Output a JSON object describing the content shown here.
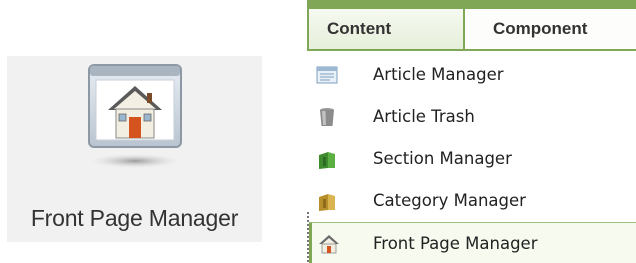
{
  "launcher": {
    "label": "Front Page Manager",
    "icon": "house-window-icon"
  },
  "menubar": {
    "tabs": [
      {
        "label": "Content",
        "active": true
      },
      {
        "label": "Component"
      }
    ]
  },
  "content_menu": {
    "items": [
      {
        "label": "Article Manager",
        "icon": "article-list-icon"
      },
      {
        "label": "Article Trash",
        "icon": "trash-can-icon"
      },
      {
        "label": "Section Manager",
        "icon": "section-book-icon"
      },
      {
        "label": "Category Manager",
        "icon": "category-book-icon"
      },
      {
        "label": "Front Page Manager",
        "icon": "home-icon",
        "active": true
      }
    ]
  },
  "colors": {
    "accent_green": "#7fa755",
    "tile_background": "#f1f1f1"
  }
}
